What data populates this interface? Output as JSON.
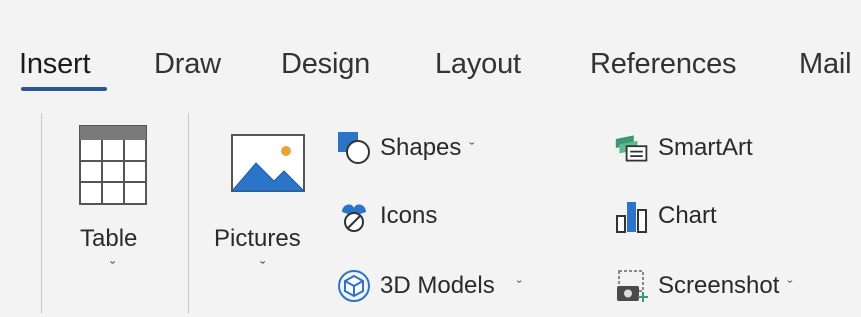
{
  "tabs": [
    {
      "label": "Insert",
      "active": true
    },
    {
      "label": "Draw"
    },
    {
      "label": "Design"
    },
    {
      "label": "Layout"
    },
    {
      "label": "References"
    },
    {
      "label": "Mail"
    }
  ],
  "ribbon": {
    "table": {
      "label": "Table",
      "icon": "table-grid-icon",
      "chevron": "ˇ"
    },
    "pictures": {
      "label": "Pictures",
      "icon": "picture-icon",
      "chevron": "ˇ"
    },
    "shapes": {
      "label": "Shapes",
      "icon": "shapes-icon",
      "chevron": "ˇ"
    },
    "icons": {
      "label": "Icons",
      "icon": "icons-icon"
    },
    "models3d": {
      "label": "3D Models",
      "icon": "cube-3d-icon",
      "chevron": "ˇ"
    },
    "smartart": {
      "label": "SmartArt",
      "icon": "smartart-icon"
    },
    "chart": {
      "label": "Chart",
      "icon": "bar-chart-icon"
    },
    "screenshot": {
      "label": "Screenshot",
      "icon": "screenshot-icon",
      "chevron": "ˇ"
    }
  },
  "colors": {
    "accent": "#2b579a",
    "icon_blue": "#2b74c8",
    "icon_green": "#3a9a6e",
    "background": "#f3f3f3"
  }
}
